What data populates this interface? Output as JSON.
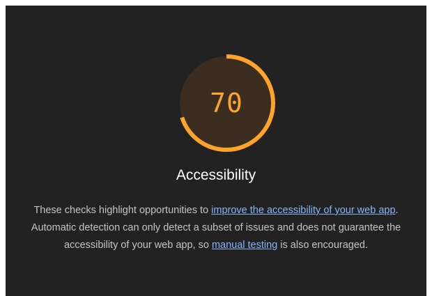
{
  "gauge": {
    "score": "70",
    "fraction": 0.7,
    "arc_color": "#ffa42a",
    "fill_color": "#3b2d1f",
    "track_color": "#222222"
  },
  "category": {
    "title": "Accessibility"
  },
  "description": {
    "text_1": "These checks highlight opportunities to ",
    "link_1": "improve the accessibility of your web app",
    "text_2": ". Automatic detection can only detect a subset of issues and does not guarantee the accessibility of your web app, so ",
    "link_2": "manual testing",
    "text_3": " is also encouraged."
  },
  "colors": {
    "background": "#222222",
    "text": "#c4c4c4",
    "link": "#8ab4f8",
    "accent": "#ffa42a"
  }
}
